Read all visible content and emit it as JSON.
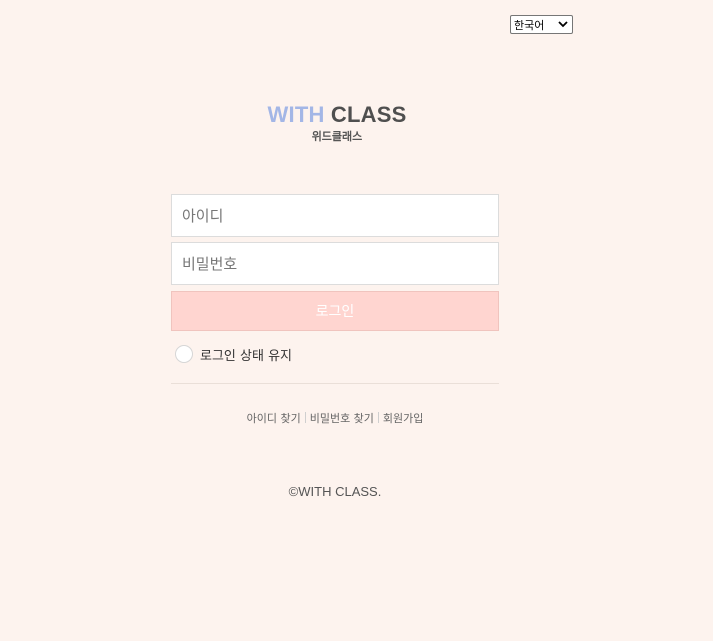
{
  "language": {
    "selected": "한국어"
  },
  "logo": {
    "title_part1": "WITH",
    "title_part2": "CLASS",
    "subtitle": "위드클래스"
  },
  "login_form": {
    "id_placeholder": "아이디",
    "password_placeholder": "비밀번호",
    "login_button": "로그인",
    "keep_logged_in_label": "로그인 상태 유지"
  },
  "footer_links": {
    "find_id": "아이디 찾기",
    "find_password": "비밀번호 찾기",
    "sign_up": "회원가입"
  },
  "copyright": "©WITH CLASS.",
  "colors": {
    "background": "#fdf3ee",
    "login_button_bg": "#ffd5d0",
    "logo_accent": "#a3b6e6"
  },
  "icons": {
    "language_dropdown": "chevron-down-icon",
    "keep_logged_in": "radio-circle"
  }
}
